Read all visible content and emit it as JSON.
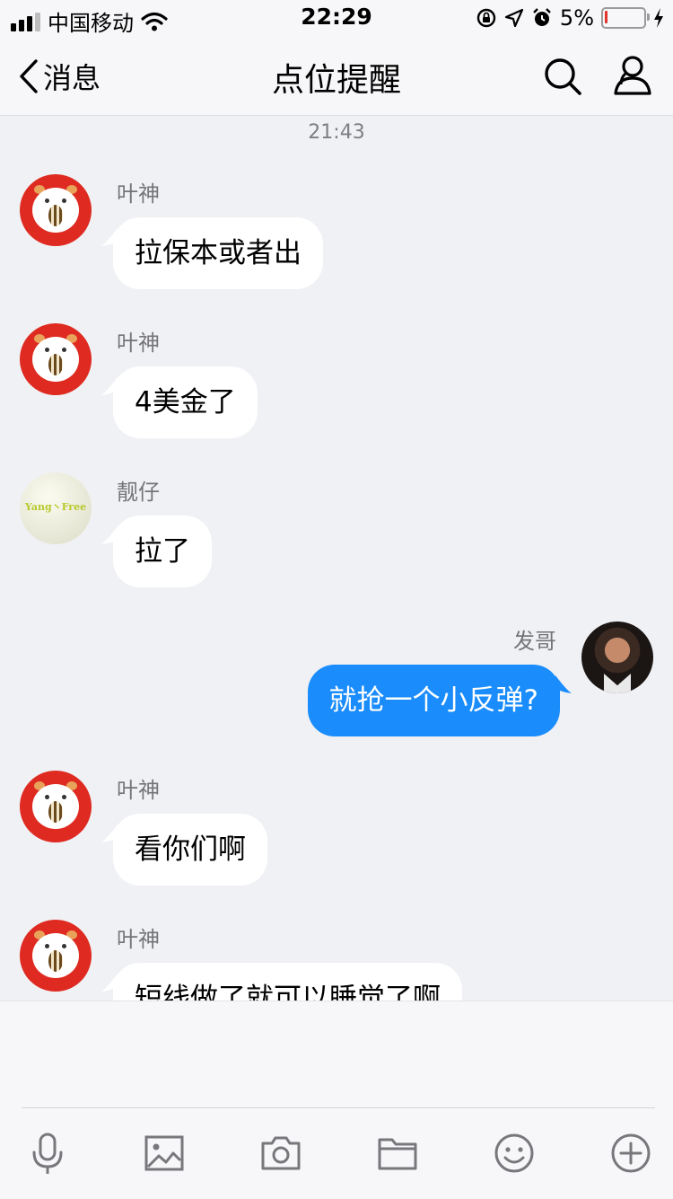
{
  "status_bar": {
    "carrier": "中国移动",
    "time": "22:29",
    "battery_percent": "5%",
    "battery_level": 0.05
  },
  "nav": {
    "back_label": "消息",
    "title": "点位提醒",
    "search_icon": "search-icon",
    "profile_icon": "group-profile-icon"
  },
  "chat": {
    "timestamp": "21:43",
    "messages": [
      {
        "sender": "叶神",
        "text": "拉保本或者出",
        "side": "in",
        "avatar": "hamster-avatar"
      },
      {
        "sender": "叶神",
        "text": "4美金了",
        "side": "in",
        "avatar": "hamster-avatar"
      },
      {
        "sender": "靓仔",
        "text": "拉了",
        "side": "in",
        "avatar": "yang-free-avatar",
        "avatar_text": "Yang丶Free"
      },
      {
        "sender": "发哥",
        "text": "就抢一个小反弹?",
        "side": "out",
        "avatar": "man-photo-avatar"
      },
      {
        "sender": "叶神",
        "text": "看你们啊",
        "side": "in",
        "avatar": "hamster-avatar"
      },
      {
        "sender": "叶神",
        "text": "短线做了就可以睡觉了啊",
        "side": "in",
        "avatar": "hamster-avatar"
      }
    ]
  },
  "colors": {
    "outgoing_bubble": "#1a8cfc",
    "incoming_bubble": "#ffffff",
    "chat_background": "#f0f1f4",
    "avatar_red": "#de2a20"
  },
  "toolbar": {
    "icons": [
      "microphone-icon",
      "image-icon",
      "camera-icon",
      "folder-icon",
      "emoji-icon",
      "plus-icon"
    ]
  }
}
